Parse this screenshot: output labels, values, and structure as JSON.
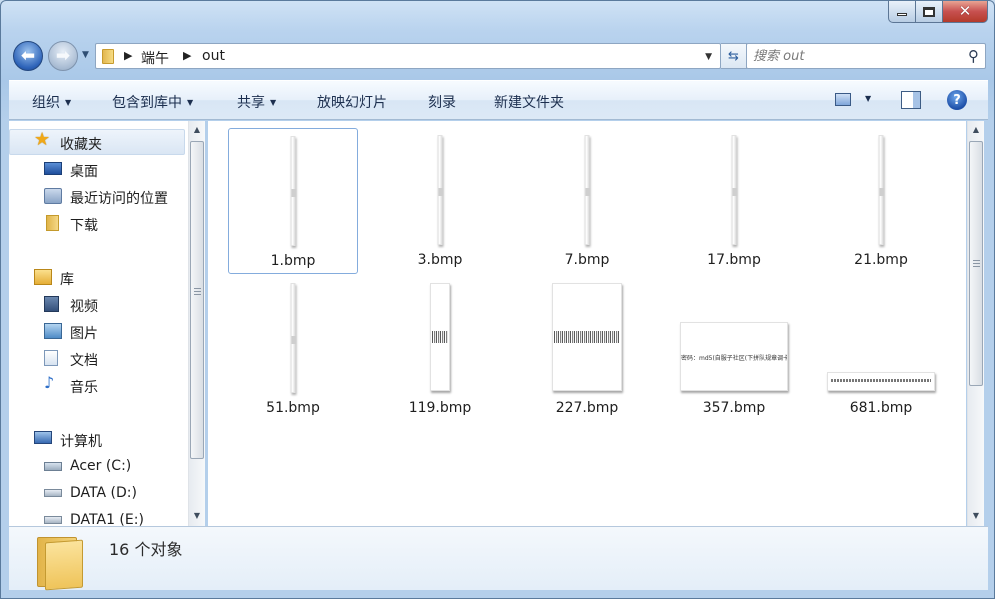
{
  "window": {
    "caption_buttons": {
      "minimize": "minimize-icon",
      "maximize": "maximize-icon",
      "close": "close-icon"
    }
  },
  "navigation": {
    "back_icon": "back-arrow-icon",
    "forward_icon": "forward-arrow-icon",
    "breadcrumb": [
      "端午",
      "out"
    ],
    "search_placeholder": "搜索 out"
  },
  "toolbar": {
    "organize": "组织",
    "include_in_library": "包含到库中",
    "share": "共享",
    "slideshow": "放映幻灯片",
    "burn": "刻录",
    "new_folder": "新建文件夹"
  },
  "sidebar": {
    "favorites": {
      "label": "收藏夹",
      "items": [
        "桌面",
        "最近访问的位置",
        "下载"
      ]
    },
    "libraries": {
      "label": "库",
      "items": [
        "视频",
        "图片",
        "文档",
        "音乐"
      ]
    },
    "computer": {
      "label": "计算机",
      "items": [
        "Acer (C:)",
        "DATA (D:)",
        "DATA1 (E:)"
      ]
    }
  },
  "files": [
    {
      "name": "1.bmp",
      "selected": true
    },
    {
      "name": "3.bmp"
    },
    {
      "name": "7.bmp"
    },
    {
      "name": "17.bmp"
    },
    {
      "name": "21.bmp"
    },
    {
      "name": "51.bmp"
    },
    {
      "name": "119.bmp"
    },
    {
      "name": "227.bmp"
    },
    {
      "name": "357.bmp",
      "thumb_text": "密码：md5(自服子社区(下拼队规章调卡节支撑)"
    },
    {
      "name": "681.bmp"
    }
  ],
  "details": {
    "item_count": "16 个对象"
  },
  "colors": {
    "window_frame": "#b9d3ee",
    "selection_border": "#84acdd",
    "toolbar": "#dde9f6"
  }
}
